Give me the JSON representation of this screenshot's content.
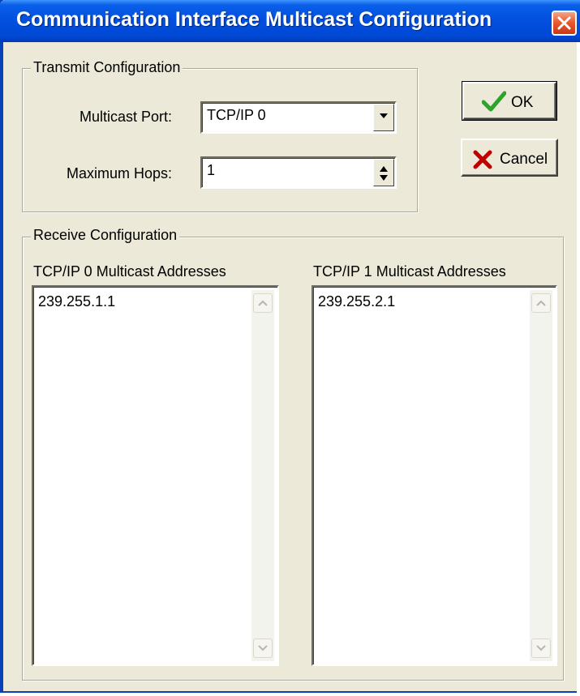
{
  "window": {
    "title": "Communication Interface Multicast Configuration"
  },
  "transmit": {
    "legend": "Transmit Configuration",
    "multicast_port_label": "Multicast Port:",
    "multicast_port_value": "TCP/IP 0",
    "max_hops_label": "Maximum Hops:",
    "max_hops_value": "1"
  },
  "buttons": {
    "ok_label": "OK",
    "cancel_label": "Cancel"
  },
  "receive": {
    "legend": "Receive Configuration",
    "lists": [
      {
        "caption": "TCP/IP 0 Multicast Addresses",
        "items": [
          "239.255.1.1"
        ]
      },
      {
        "caption": "TCP/IP 1 Multicast Addresses",
        "items": [
          "239.255.2.1"
        ]
      }
    ]
  },
  "colors": {
    "titlebar": "#0250e0",
    "face": "#ece9d8",
    "ok_check": "#2aa52a",
    "cancel_x": "#c00000"
  },
  "icons": {
    "close": "close-icon",
    "combo": "chevron-down-icon",
    "spin": "spin-arrows-icon",
    "ok": "checkmark-icon",
    "cancel": "x-mark-icon",
    "scroll_up": "chevron-up-icon",
    "scroll_down": "chevron-down-icon"
  }
}
